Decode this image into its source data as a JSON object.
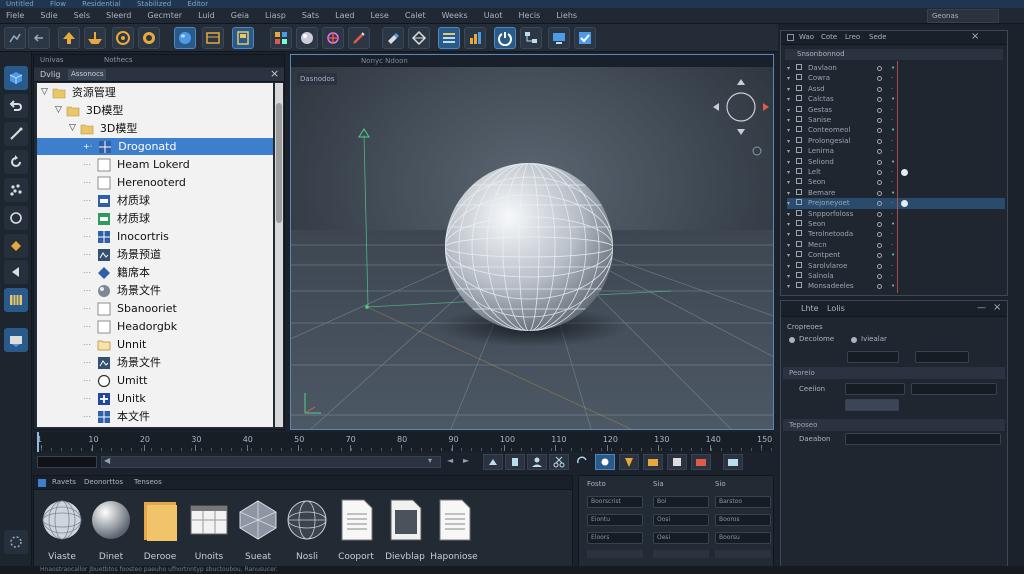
{
  "colors": {
    "accent": "#3d7fcc",
    "viewport_border": "#5b86b8",
    "axis_green": "#4fd08a",
    "axis_red": "#e05a4a",
    "folder": "#e8c66a",
    "timeline_accent": "#2f6fb5"
  },
  "title_bar": [
    "Untitled",
    "Flow",
    "Residential",
    "Stabilized",
    "Editor"
  ],
  "menu": [
    "Fiele",
    "Sdie",
    "Sels",
    "Sleerd",
    "Gecmter",
    "Luid",
    "Geia",
    "Liasp",
    "Sats",
    "Laed",
    "Lese",
    "Calet",
    "Weeks",
    "Uaot",
    "Hecis",
    "Liehs"
  ],
  "asset_panel": {
    "tabs": [
      "Univas",
      "Nothecs"
    ],
    "header_tabs": [
      "Dvlig",
      "Assonocs"
    ],
    "tree": [
      {
        "label": "资源管理",
        "level": 0,
        "icon": "folder-icon",
        "expanded": true
      },
      {
        "label": "3D模型",
        "level": 1,
        "icon": "folder-icon",
        "expanded": true
      },
      {
        "label": "3D模型",
        "level": 2,
        "icon": "folder-icon",
        "expanded": true
      },
      {
        "label": "Drogonatd",
        "level": 3,
        "icon": "grid-icon",
        "selected": true
      },
      {
        "label": "Heam Lokerd",
        "level": 3,
        "icon": "blank-doc-icon"
      },
      {
        "label": "Herenooterd",
        "level": 3,
        "icon": "blank-doc-icon"
      },
      {
        "label": "材质球",
        "level": 3,
        "icon": "material-icon"
      },
      {
        "label": "材质球",
        "level": 3,
        "icon": "material-green-icon"
      },
      {
        "label": "Inocortris",
        "level": 3,
        "icon": "grid-icon"
      },
      {
        "label": "场景预道",
        "level": 3,
        "icon": "scene-icon"
      },
      {
        "label": "籍席本",
        "level": 3,
        "icon": "diamond-icon"
      },
      {
        "label": "场景文件",
        "level": 3,
        "icon": "sphere-icon"
      },
      {
        "label": "Sbanooriet",
        "level": 3,
        "icon": "blank-doc-icon"
      },
      {
        "label": "Headorgbk",
        "level": 3,
        "icon": "blank-doc-icon"
      },
      {
        "label": "Unnit",
        "level": 3,
        "icon": "folder-outline-icon"
      },
      {
        "label": "场景文件",
        "level": 3,
        "icon": "scene-icon"
      },
      {
        "label": "Umitt",
        "level": 3,
        "icon": "circle-icon"
      },
      {
        "label": "Unitk",
        "level": 3,
        "icon": "cross-icon"
      },
      {
        "label": "本文件",
        "level": 3,
        "icon": "grid-icon"
      }
    ]
  },
  "viewport": {
    "tab_label": "Dasnodos",
    "tab_label_2": "Nonyc Ndoon"
  },
  "timeline": {
    "ticks": [
      "1",
      "10",
      "20",
      "30",
      "40",
      "50",
      "70",
      "80",
      "90",
      "100",
      "110",
      "120",
      "130",
      "140",
      "150"
    ]
  },
  "browser": {
    "tabs": [
      "Ravets",
      "Deonorttos",
      "Tenseos"
    ],
    "items": [
      {
        "label": "Viaste",
        "icon": "wireframe-sphere-icon"
      },
      {
        "label": "Dinet",
        "icon": "sphere-icon"
      },
      {
        "label": "Derooe",
        "icon": "folder-icon"
      },
      {
        "label": "Unoits",
        "icon": "window-icon"
      },
      {
        "label": "Sueat",
        "icon": "polyhedron-icon"
      },
      {
        "label": "Nosli",
        "icon": "globe-icon"
      },
      {
        "label": "Cooport",
        "icon": "document-icon"
      },
      {
        "label": "Dievblap",
        "icon": "document-dark-icon"
      },
      {
        "label": "Haponiose",
        "icon": "document-icon"
      }
    ]
  },
  "grid_panel": {
    "headers": [
      "Fosto",
      "Sia",
      "Sio"
    ],
    "rows": [
      [
        "Boorscrist",
        "Boi",
        "Barstoo"
      ],
      [
        "Eiontu",
        "Oosi",
        "Booros"
      ],
      [
        "Eloors",
        "Oesi",
        "Boorsu"
      ]
    ]
  },
  "outliner": {
    "tabs": [
      "Wao",
      "Cote",
      "Lreo",
      "Sede"
    ],
    "search": "Geonas",
    "header": "Snsonbonnod",
    "rows": [
      "Davlaon",
      "Cowra",
      "Assd",
      "Calctas",
      "Gestas",
      "Sanise",
      "Conteomeol",
      "Prolongesial",
      "Lenirna",
      "Seliond",
      "Lelt",
      "Seon",
      "Bemare",
      "Prejoneyoet",
      "Snpporfoloss",
      "Seon",
      "Terolnetooda",
      "Mecn",
      "Contpent",
      "Sarolvlaroe",
      "Salnola",
      "Monsadeeles"
    ]
  },
  "inspector": {
    "tabs": [
      "Lhte",
      "Lolis"
    ],
    "section1": "Cropreoes",
    "row1": [
      "Decolome",
      "Iviealar"
    ],
    "section2": "Peoreio",
    "row2": "Ceeiion",
    "section3": "Teposeo",
    "row3": "Daeabon"
  },
  "status": "Hnaostraocallor Jbuetbtos foosteo paeuho ufhortnntyp sbuctoubou, Ranusucer."
}
